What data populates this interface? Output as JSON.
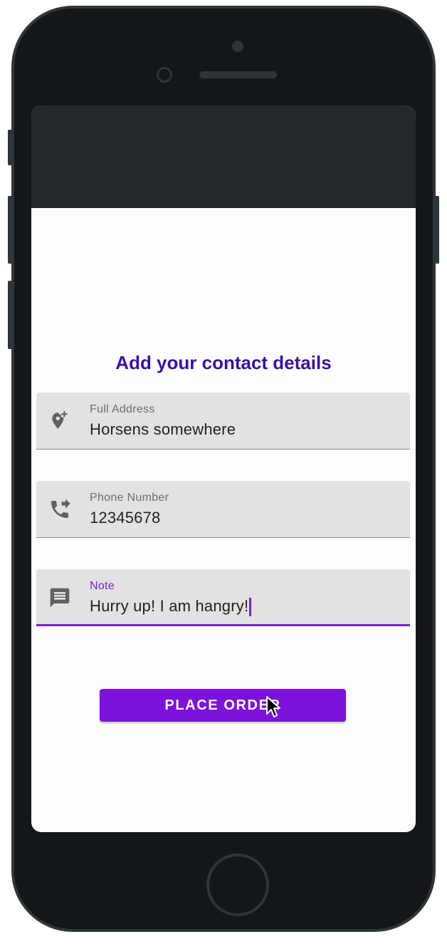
{
  "screen": {
    "title": "Add your contact details",
    "fields": [
      {
        "label": "Full Address",
        "value": "Horsens somewhere",
        "icon": "add-location-icon"
      },
      {
        "label": "Phone Number",
        "value": "12345678",
        "icon": "phone-forwarded-icon"
      },
      {
        "label": "Note",
        "value": "Hurry up! I am hangry!",
        "icon": "message-icon"
      }
    ],
    "place_order_label": "PLACE ORDER"
  },
  "colors": {
    "accent": "#7e12dd",
    "title": "#3a10a8",
    "field_bg": "#e2e2e2",
    "device_body": "#141719"
  }
}
